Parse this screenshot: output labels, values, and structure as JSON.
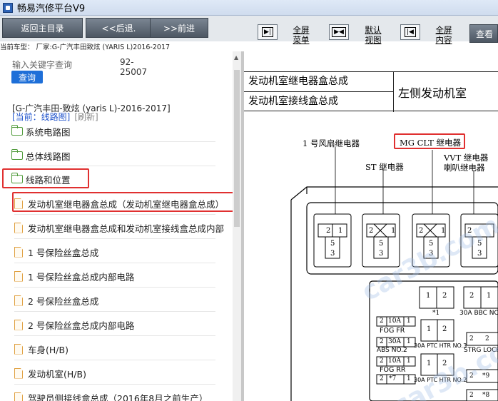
{
  "window": {
    "title": "畅易汽修平台V9"
  },
  "toolbar": {
    "home": "返回主目录",
    "back": "<<后退.",
    "forward": ">>前进",
    "fullscreen_menu_1": "全屏",
    "fullscreen_menu_2": "菜单",
    "default_view_1": "默认",
    "default_view_2": "视图",
    "fullscreen_content_1": "全屏",
    "fullscreen_content_2": "内容",
    "search": "查看"
  },
  "vehicle_bar": "当前车型： 厂家:G-广汽丰田致炫 (YARIS L)2016-2017",
  "left": {
    "search_placeholder": "输入关键字查询",
    "code": "92-25007",
    "query_label": "查询",
    "vehicle_path": "[G-广汽丰田-致炫 (yaris L)-2016-2017]",
    "current": "[当前：线路图]",
    "refresh": "[刷新]",
    "tree": [
      {
        "label": "系统电路图",
        "type": "folder"
      },
      {
        "label": "总体线路图",
        "type": "folder"
      },
      {
        "label": "线路和位置",
        "type": "folder"
      },
      {
        "label": "发动机室继电器盒总成（发动机室继电器盒总成）",
        "type": "doc"
      },
      {
        "label": "发动机室继电器盒总成和发动机室接线盒总成内部",
        "type": "doc"
      },
      {
        "label": "1 号保险丝盒总成",
        "type": "doc"
      },
      {
        "label": "1 号保险丝盒总成内部电路",
        "type": "doc"
      },
      {
        "label": "2 号保险丝盒总成",
        "type": "doc"
      },
      {
        "label": "2 号保险丝盒总成内部电路",
        "type": "doc"
      },
      {
        "label": "车身(H/B)",
        "type": "doc"
      },
      {
        "label": "发动机室(H/B)",
        "type": "doc"
      },
      {
        "label": "驾驶员侧接线盒总成（2016年8月之前生产）",
        "type": "doc"
      }
    ]
  },
  "right": {
    "hdr_row1": "发动机室继电器盒总成",
    "hdr_row2": "发动机室接线盒总成",
    "hdr_right": "左侧发动机室",
    "labels": {
      "fan": "1 号风扇继电器",
      "mg": "MG CLT 继电器",
      "st": "ST 继电器",
      "vvt": "VVT 继电器",
      "horn": "喇叭继电器",
      "r1": "*1",
      "abbc": "30A BBC NO",
      "fogfr": "FOG FR",
      "absno2": "ABS NO.2",
      "fogrr": "FOG RR",
      "ptc3": "30A PTC HTR NO.3",
      "ptc2": "30A PTC HTR NO.2",
      "strg": "STRG LOCK",
      "n2": "2",
      "n1": "1",
      "n5": "5",
      "n3": "3",
      "a10": "10A",
      "a30": "30A",
      "star7": "*7",
      "star9": "*9",
      "n8": "*8",
      "watermark": "car3b.com"
    }
  }
}
